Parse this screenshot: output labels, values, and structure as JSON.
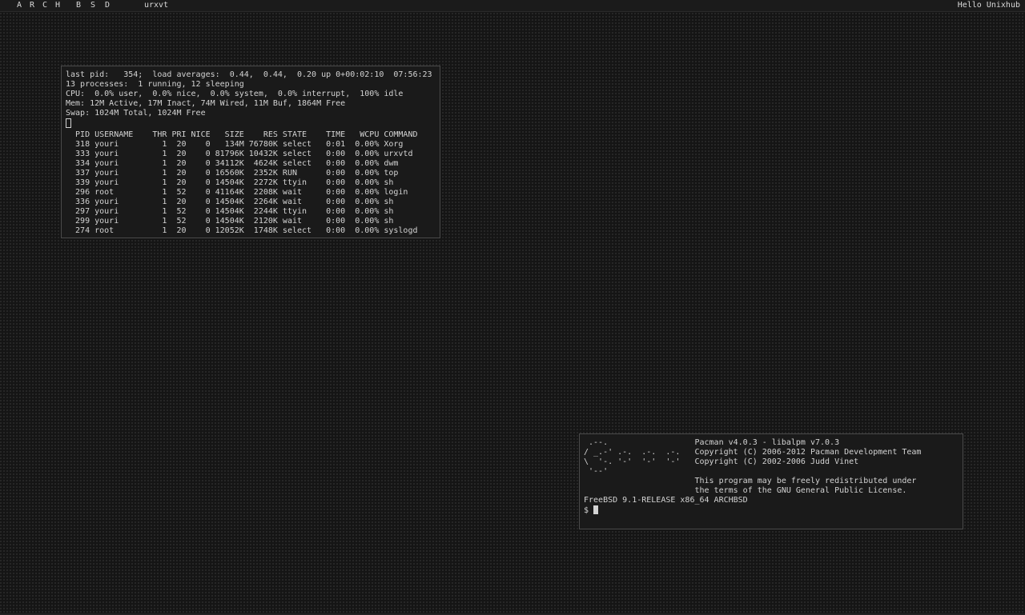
{
  "bar": {
    "tags": [
      "A",
      "R",
      "C",
      "H",
      "B",
      "S",
      "D"
    ],
    "window_title": "urxvt",
    "status": "Hello Unixhub"
  },
  "top_terminal": {
    "lines": [
      "last pid:   354;  load averages:  0.44,  0.44,  0.20 up 0+00:02:10  07:56:23",
      "13 processes:  1 running, 12 sleeping",
      "CPU:  0.0% user,  0.0% nice,  0.0% system,  0.0% interrupt,  100% idle",
      "Mem: 12M Active, 17M Inact, 74M Wired, 11M Buf, 1864M Free",
      "Swap: 1024M Total, 1024M Free"
    ],
    "header": "  PID USERNAME    THR PRI NICE   SIZE    RES STATE    TIME   WCPU COMMAND",
    "rows": [
      "  318 youri         1  20    0   134M 76780K select   0:01  0.00% Xorg",
      "  333 youri         1  20    0 81796K 10432K select   0:00  0.00% urxvtd",
      "  334 youri         1  20    0 34112K  4624K select   0:00  0.00% dwm",
      "  337 youri         1  20    0 16560K  2352K RUN      0:00  0.00% top",
      "  339 youri         1  20    0 14504K  2272K ttyin    0:00  0.00% sh",
      "  296 root          1  52    0 41164K  2208K wait     0:00  0.00% login",
      "  336 youri         1  20    0 14504K  2264K wait     0:00  0.00% sh",
      "  297 youri         1  52    0 14504K  2244K ttyin    0:00  0.00% sh",
      "  299 youri         1  52    0 14504K  2120K wait     0:00  0.00% sh",
      "  274 root          1  20    0 12052K  1748K select   0:00  0.00% syslogd"
    ]
  },
  "pacman_terminal": {
    "lines": [
      " .--.                  Pacman v4.0.3 - libalpm v7.0.3",
      "/ _.-' .-.  .-.  .-.   Copyright (C) 2006-2012 Pacman Development Team",
      "\\  '-. '-'  '-'  '-'   Copyright (C) 2002-2006 Judd Vinet",
      " '--'",
      "                       This program may be freely redistributed under",
      "                       the terms of the GNU General Public License.",
      "",
      "FreeBSD 9.1-RELEASE x86_64 ARCHBSD"
    ],
    "prompt": "$ "
  },
  "colors": {
    "background": "#151515",
    "terminal_bg": "#1a1a1a",
    "text": "#d3d3d3"
  }
}
